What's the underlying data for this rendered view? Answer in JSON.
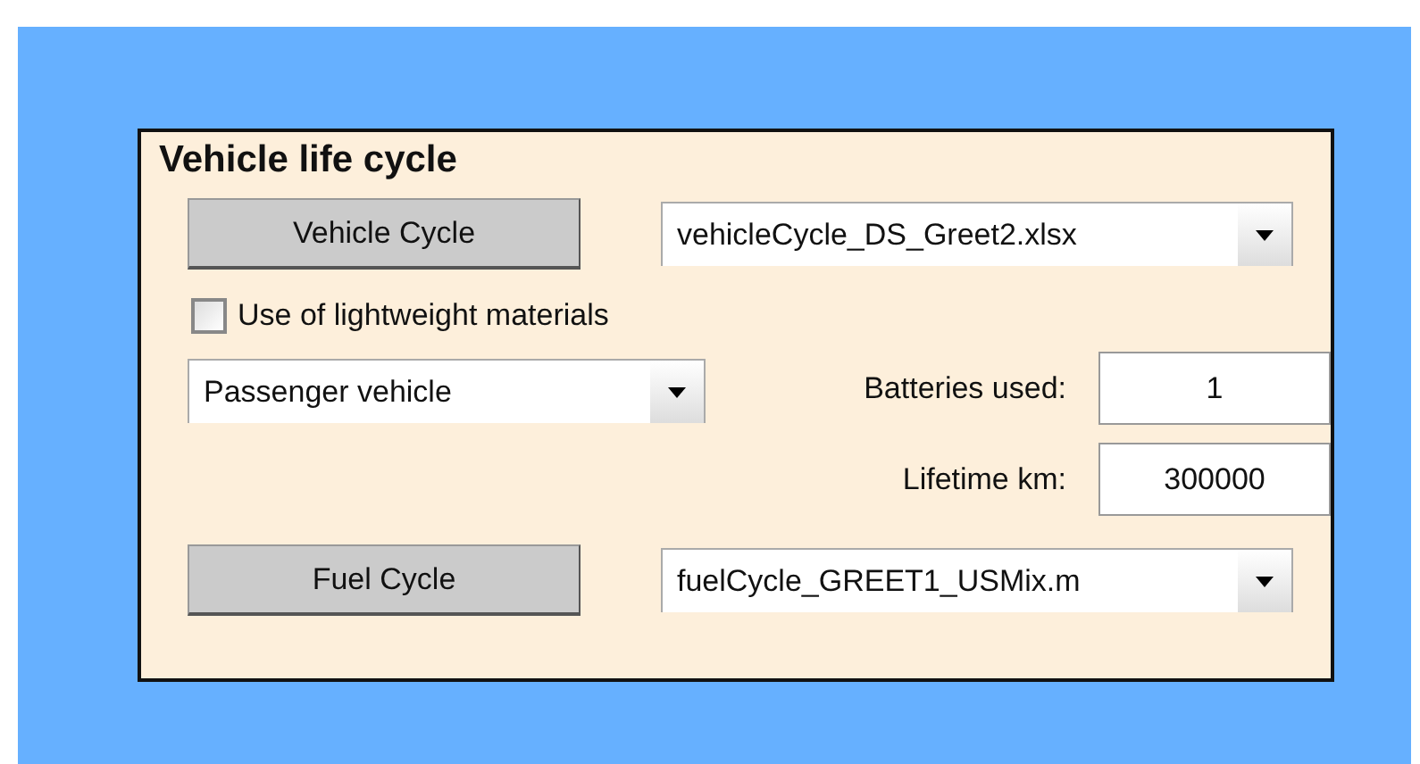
{
  "panel": {
    "title": "Vehicle life cycle"
  },
  "vehicle_cycle": {
    "button": "Vehicle Cycle",
    "file": "vehicleCycle_DS_Greet2.xlsx"
  },
  "lightweight": {
    "label": "Use of lightweight materials",
    "checked": false
  },
  "vehicle_type": {
    "value": "Passenger vehicle"
  },
  "fields": [
    {
      "label": "Batteries used:",
      "value": "1"
    },
    {
      "label": "Lifetime km:",
      "value": "300000"
    }
  ],
  "fuel_cycle": {
    "button": "Fuel Cycle",
    "file": "fuelCycle_GREET1_USMix.m"
  }
}
